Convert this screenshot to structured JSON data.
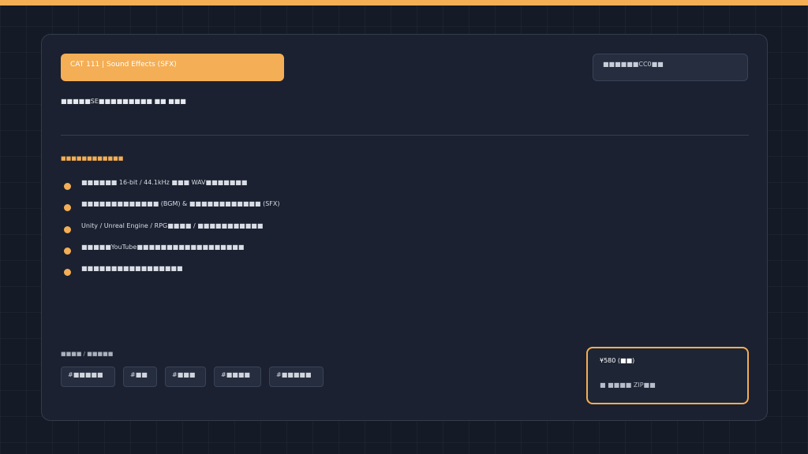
{
  "header": {
    "category_badge": "CAT 111 | Sound Effects (SFX)",
    "license_badge": "■■■■■■CC0■■"
  },
  "subtitle": "■■■■■SE■■■■■■■■■ ■■ ■■■",
  "section_heading": "■■■■■■■■■■■■",
  "features": [
    "■■■■■■ 16-bit / 44.1kHz ■■■ WAV■■■■■■■",
    "■■■■■■■■■■■■■ (BGM) & ■■■■■■■■■■■■ (SFX)",
    "Unity / Unreal Engine / RPG■■■■ / ■■■■■■■■■■■",
    "■■■■■YouTube■■■■■■■■■■■■■■■■■■",
    "■■■■■■■■■■■■■■■■■"
  ],
  "tags_label": "■■■■ / ■■■■■",
  "tags": [
    "#■■■■■",
    "#■■",
    "#■■■",
    "#■■■■",
    "#■■■■■"
  ],
  "price_box": {
    "price": "¥580 (■■)",
    "format": "■ ■■■■ ZIP■■"
  },
  "colors": {
    "accent": "#f4ae55",
    "card_bg": "#1b2130",
    "page_bg": "#141a26"
  }
}
